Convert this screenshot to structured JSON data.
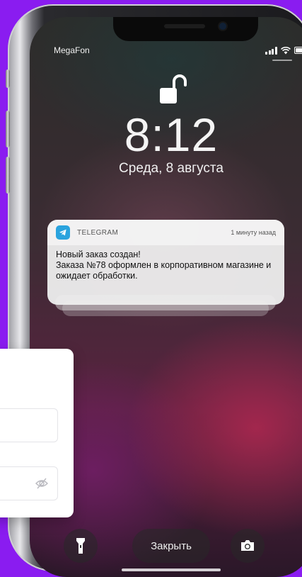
{
  "status_bar": {
    "carrier": "MegaFon",
    "signal_bars": 4,
    "wifi": true,
    "battery": "full"
  },
  "lock_screen": {
    "lock_icon": "unlocked-padlock-icon",
    "time": "8:12",
    "date": "Среда, 8 августа"
  },
  "notification": {
    "app_icon": "telegram-icon",
    "app_name": "TELEGRAM",
    "time_ago": "1 минуту назад",
    "title": "Новый заказ создан!",
    "body": "Заказа №78 оформлен в корпоративном магазине и ожидает обработки."
  },
  "bottom_controls": {
    "flashlight_icon": "flashlight-icon",
    "close_label": "Закрыть",
    "camera_icon": "camera-icon"
  },
  "login_card": {
    "field_1_value": "",
    "field_2_value": "",
    "password_toggle_icon": "eye-slash-icon"
  },
  "colors": {
    "background": "#8a1cf0",
    "telegram_blue": "#2aa3de"
  }
}
